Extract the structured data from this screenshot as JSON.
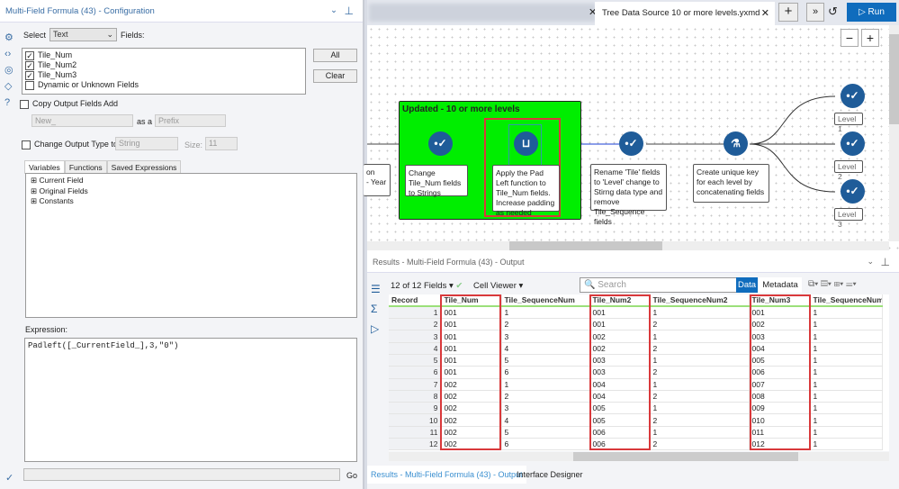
{
  "config": {
    "title": "Multi-Field Formula (43) - Configuration",
    "select_label": "Select",
    "select_value": "Text",
    "fields_label": "Fields:",
    "fields": [
      {
        "name": "Tile_Num",
        "checked": true
      },
      {
        "name": "Tile_Num2",
        "checked": true
      },
      {
        "name": "Tile_Num3",
        "checked": true
      },
      {
        "name": "Dynamic or Unknown Fields",
        "checked": false
      }
    ],
    "all_button": "All",
    "clear_button": "Clear",
    "copy_output_label": "Copy Output Fields Add",
    "copy_prefix_value": "New_",
    "as_a_label": "as a",
    "prefix_select": "Prefix",
    "change_type_label": "Change Output Type to",
    "type_select": "String",
    "size_label": "Size:",
    "size_value": "11",
    "tabs": [
      "Variables",
      "Functions",
      "Saved Expressions"
    ],
    "tree": [
      "Current Field",
      "Original Fields",
      "Constants"
    ],
    "expression_label": "Expression:",
    "expression": "Padleft([_CurrentField_],3,\"0\")",
    "go_button": "Go"
  },
  "canvas": {
    "active_tab": "Tree Data Source 10 or more levels.yxmd",
    "run_button": "Run",
    "container_title": "Updated - 10 or more levels",
    "container_color": "#00ee00",
    "notes": [
      "on\n- Year",
      "Change Tile_Num fields to Strings",
      "Apply the Pad Left function to Tile_Num fields. Increase padding as needed",
      "Rename 'Tile' fields to 'Level' change to Stirng data type and remove Tile_Sequence fields",
      "Create unique key for each level by concatenating fields"
    ],
    "levels": [
      "Level 1",
      "Level 2",
      "Level 3"
    ]
  },
  "results": {
    "title": "Results - Multi-Field Formula (43) - Output",
    "fields_count": "12 of 12 Fields",
    "cell_viewer": "Cell Viewer",
    "search_placeholder": "Search",
    "data_tab": "Data",
    "metadata_tab": "Metadata",
    "columns": [
      "Record",
      "Tile_Num",
      "Tile_SequenceNum",
      "Tile_Num2",
      "Tile_SequenceNum2",
      "Tile_Num3",
      "Tile_SequenceNum3"
    ],
    "rows": [
      [
        "1",
        "001",
        "1",
        "001",
        "1",
        "001",
        "1"
      ],
      [
        "2",
        "001",
        "2",
        "001",
        "2",
        "002",
        "1"
      ],
      [
        "3",
        "001",
        "3",
        "002",
        "1",
        "003",
        "1"
      ],
      [
        "4",
        "001",
        "4",
        "002",
        "2",
        "004",
        "1"
      ],
      [
        "5",
        "001",
        "5",
        "003",
        "1",
        "005",
        "1"
      ],
      [
        "6",
        "001",
        "6",
        "003",
        "2",
        "006",
        "1"
      ],
      [
        "7",
        "002",
        "1",
        "004",
        "1",
        "007",
        "1"
      ],
      [
        "8",
        "002",
        "2",
        "004",
        "2",
        "008",
        "1"
      ],
      [
        "9",
        "002",
        "3",
        "005",
        "1",
        "009",
        "1"
      ],
      [
        "10",
        "002",
        "4",
        "005",
        "2",
        "010",
        "1"
      ],
      [
        "11",
        "002",
        "5",
        "006",
        "1",
        "011",
        "1"
      ],
      [
        "12",
        "002",
        "6",
        "006",
        "2",
        "012",
        "1"
      ]
    ],
    "bottom_tabs": [
      "Results - Multi-Field Formula (43) - Output",
      "Interface Designer"
    ]
  },
  "colors": {
    "accent": "#0f6cbd",
    "highlight": "#d9393b",
    "node": "#1f5c99"
  }
}
